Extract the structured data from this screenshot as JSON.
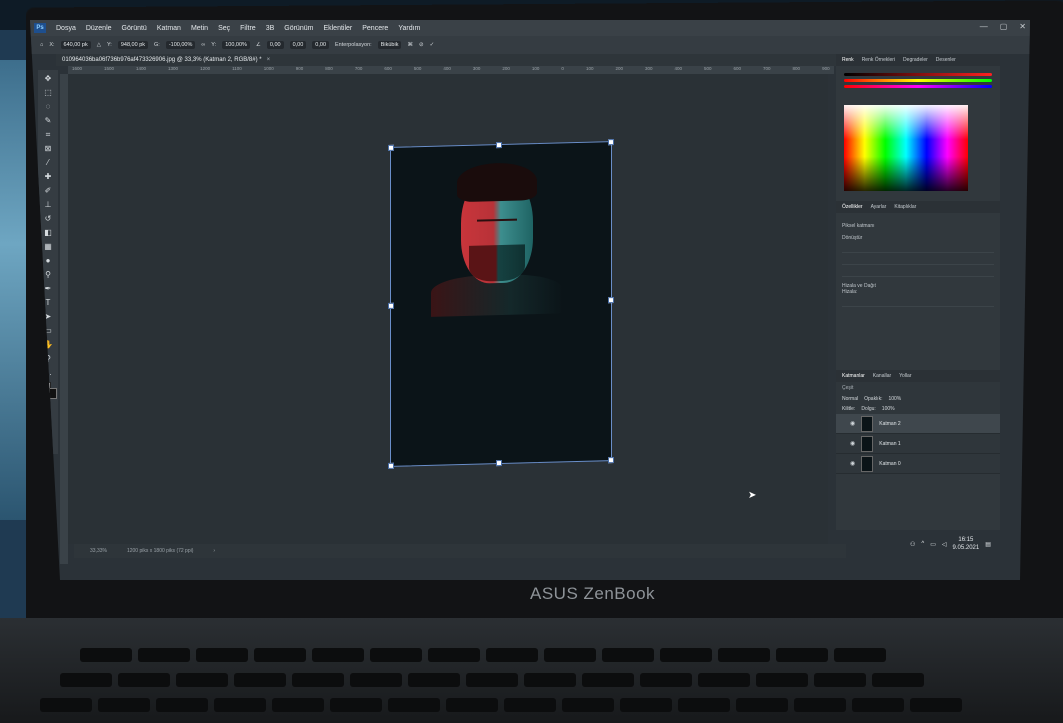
{
  "photoshop": {
    "logo": "Ps",
    "menu": [
      "Dosya",
      "Düzenle",
      "Görüntü",
      "Katman",
      "Metin",
      "Seç",
      "Filtre",
      "3B",
      "Görünüm",
      "Eklentiler",
      "Pencere",
      "Yardım"
    ],
    "options": {
      "x_label": "X:",
      "x_value": "640,00 pk",
      "y_label": "Y:",
      "y_value": "948,00 pk",
      "w_label": "G:",
      "w_value": "-100,00%",
      "h_label": "Y:",
      "h_value": "100,00%",
      "angle_value": "0,00",
      "h_skew_value": "0,00",
      "v_skew_value": "0,00",
      "interp_label": "Enterpolasyon:",
      "interp_value": "Bikübik"
    },
    "document_tab": "010964036ba06f736b976af473326906.jpg @ 33,3% (Katman 2, RGB/8#) *",
    "ruler_ticks": [
      "1600",
      "1500",
      "1400",
      "1300",
      "1200",
      "1100",
      "1000",
      "900",
      "800",
      "700",
      "600",
      "500",
      "400",
      "300",
      "200",
      "100",
      "0",
      "100",
      "200",
      "300",
      "400",
      "500",
      "600",
      "700",
      "800",
      "900",
      "1000",
      "1100",
      "1200",
      "1300",
      "1400",
      "1500",
      "1600",
      "1700",
      "1800",
      "1900",
      "2000"
    ],
    "status": {
      "zoom": "33,33%",
      "doc_size": "1200 piks x 1800 piks (72 ppi)"
    },
    "color_panel_tabs": [
      "Renk",
      "Renk Örnekleri",
      "Degradeler",
      "Desenler"
    ],
    "properties_tabs": [
      "Özellikler",
      "Ayarlar",
      "Kitaplıklar"
    ],
    "properties": {
      "type": "Piksel katmanı",
      "transform_heading": "Dönüştür",
      "align_heading": "Hizala ve Dağıt",
      "align_sub": "Hizala:"
    },
    "layers_tabs": [
      "Katmanlar",
      "Kanallar",
      "Yollar"
    ],
    "layers_controls": {
      "search": "Çeşit",
      "blend": "Normal",
      "opacity_label": "Opaklık:",
      "opacity": "100%",
      "fill_label": "Dolgu:",
      "fill": "100%",
      "lock_label": "Kilitle:"
    },
    "layers": [
      {
        "name": "Katman 2",
        "selected": true
      },
      {
        "name": "Katman 1",
        "selected": false
      },
      {
        "name": "Katman 0",
        "selected": false
      }
    ],
    "taskbar": {
      "time": "16:15",
      "date": "9.05.2021"
    }
  },
  "laptop": {
    "brand": "ASUS ZenBook"
  }
}
